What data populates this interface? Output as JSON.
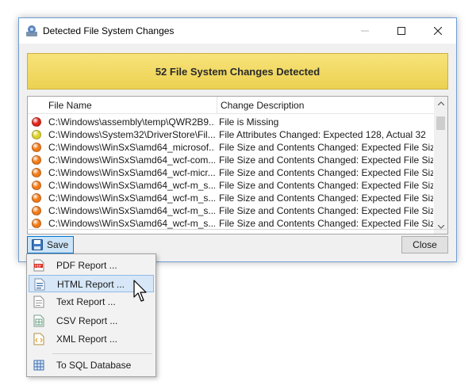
{
  "window": {
    "title": "Detected File System Changes",
    "banner": "52 File System Changes Detected",
    "columns": {
      "file_name": "File Name",
      "change_description": "Change Description"
    },
    "rows": [
      {
        "status": "red",
        "file": "C:\\Windows\\assembly\\temp\\QWR2B9...",
        "desc": "File is Missing"
      },
      {
        "status": "yellow",
        "file": "C:\\Windows\\System32\\DriverStore\\Fil...",
        "desc": "File Attributes Changed: Expected 128, Actual 32"
      },
      {
        "status": "orange",
        "file": "C:\\Windows\\WinSxS\\amd64_microsof...",
        "desc": "File Size and Contents Changed: Expected File Siz..."
      },
      {
        "status": "orange",
        "file": "C:\\Windows\\WinSxS\\amd64_wcf-com...",
        "desc": "File Size and Contents Changed: Expected File Siz..."
      },
      {
        "status": "orange",
        "file": "C:\\Windows\\WinSxS\\amd64_wcf-micr...",
        "desc": "File Size and Contents Changed: Expected File Siz..."
      },
      {
        "status": "orange",
        "file": "C:\\Windows\\WinSxS\\amd64_wcf-m_s...",
        "desc": "File Size and Contents Changed: Expected File Siz..."
      },
      {
        "status": "orange",
        "file": "C:\\Windows\\WinSxS\\amd64_wcf-m_s...",
        "desc": "File Size and Contents Changed: Expected File Siz..."
      },
      {
        "status": "orange",
        "file": "C:\\Windows\\WinSxS\\amd64_wcf-m_s...",
        "desc": "File Size and Contents Changed: Expected File Siz..."
      },
      {
        "status": "orange",
        "file": "C:\\Windows\\WinSxS\\amd64_wcf-m_s...",
        "desc": "File Size and Contents Changed: Expected File Siz..."
      }
    ],
    "save_label": "Save",
    "close_label": "Close"
  },
  "menu": {
    "items": [
      {
        "label": "PDF Report ...",
        "icon": "pdf-icon"
      },
      {
        "label": "HTML Report ...",
        "icon": "html-icon"
      },
      {
        "label": "Text Report ...",
        "icon": "text-icon"
      },
      {
        "label": "CSV Report ...",
        "icon": "csv-icon"
      },
      {
        "label": "XML Report ...",
        "icon": "xml-icon"
      },
      {
        "label": "To SQL Database",
        "icon": "database-icon"
      }
    ],
    "highlighted_item": "HTML Report ..."
  },
  "colors": {
    "red": "#e02418",
    "yellow": "#ddd22a",
    "orange": "#f27a17",
    "banner": "#f2dc66",
    "accent": "#0078d7"
  }
}
